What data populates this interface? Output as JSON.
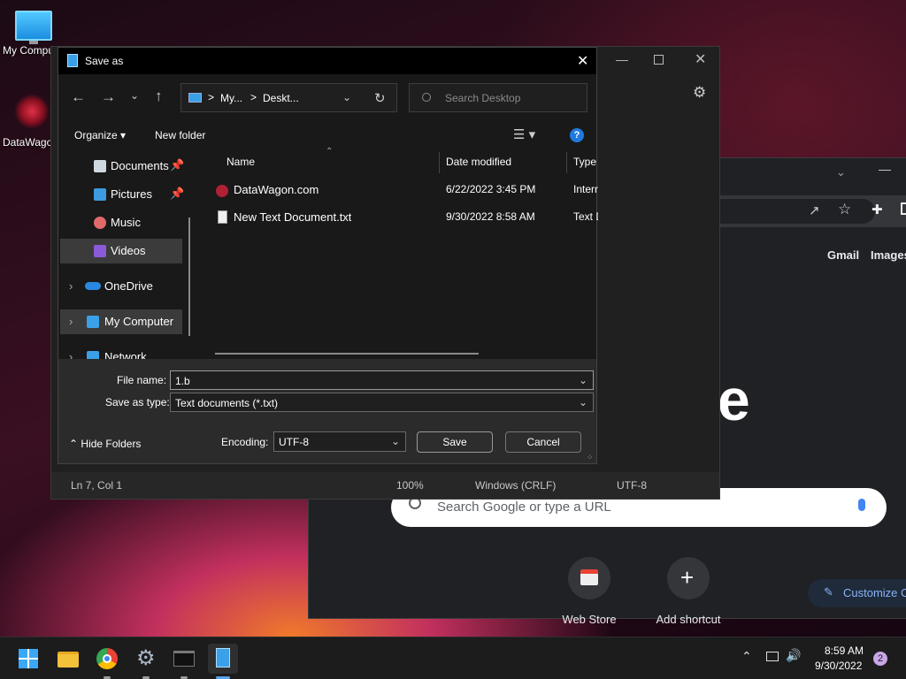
{
  "desktop": {
    "icons": [
      {
        "label": "My Computer"
      },
      {
        "label": "DataWagon.com"
      }
    ]
  },
  "chrome": {
    "links": [
      "Gmail",
      "Images"
    ],
    "logo_fragment": "e",
    "search_placeholder": "Search Google or type a URL",
    "shortcuts": [
      {
        "label": "Web Store"
      },
      {
        "label": "Add shortcut"
      }
    ],
    "customize_label": "Customize C"
  },
  "notepad": {
    "status": {
      "position": "Ln 7, Col 1",
      "zoom": "100%",
      "line_ending": "Windows (CRLF)",
      "encoding": "UTF-8"
    }
  },
  "dialog": {
    "title": "Save as",
    "breadcrumb": [
      "My...",
      "Deskt..."
    ],
    "search_placeholder": "Search Desktop",
    "toolbar": {
      "organize": "Organize",
      "new_folder": "New folder"
    },
    "nav": [
      {
        "label": "Documents",
        "pinned": true
      },
      {
        "label": "Pictures",
        "pinned": true
      },
      {
        "label": "Music"
      },
      {
        "label": "Videos",
        "selected": true
      },
      {
        "label": "OneDrive"
      },
      {
        "label": "My Computer"
      },
      {
        "label": "Network"
      }
    ],
    "columns": [
      "Name",
      "Date modified",
      "Type"
    ],
    "files": [
      {
        "name": "DataWagon.com",
        "date": "6/22/2022 3:45 PM",
        "type": "Intern"
      },
      {
        "name": "New Text Document.txt",
        "date": "9/30/2022 8:58 AM",
        "type": "Text D"
      }
    ],
    "file_name_label": "File name:",
    "file_name_value": "1.b",
    "save_type_label": "Save as type:",
    "save_type_value": "Text documents (*.txt)",
    "hide_folders": "Hide Folders",
    "encoding_label": "Encoding:",
    "encoding_value": "UTF-8",
    "save": "Save",
    "cancel": "Cancel"
  },
  "taskbar": {
    "time": "8:59 AM",
    "date": "9/30/2022",
    "notifications": "2"
  }
}
